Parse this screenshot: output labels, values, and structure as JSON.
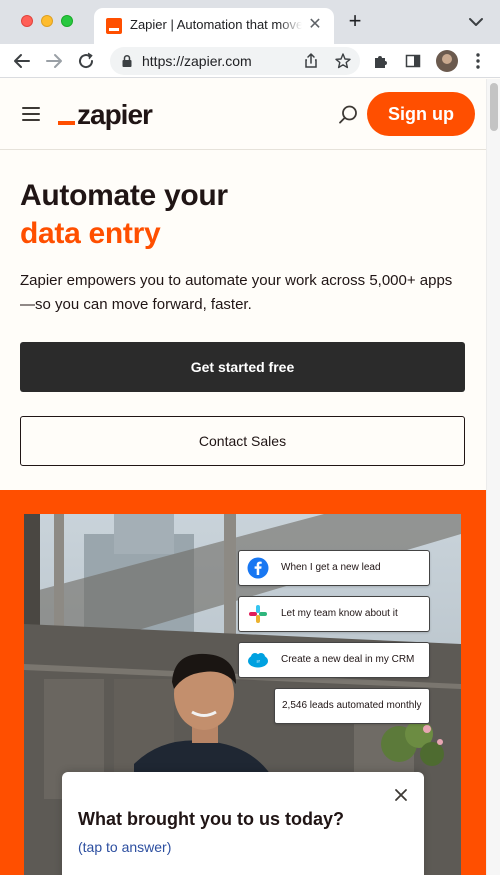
{
  "browser": {
    "tab_title": "Zapier | Automation that moves you forward",
    "tab_close": "✕",
    "new_tab": "+",
    "url": "https://zapier.com"
  },
  "header": {
    "logo_text": "zapier",
    "signup_label": "Sign up"
  },
  "hero": {
    "title_line1": "Automate your",
    "title_line2": "data entry",
    "subtitle": "Zapier empowers you to automate your work across 5,000+ apps —so you can move forward, faster.",
    "cta_primary": "Get started free",
    "cta_secondary": "Contact Sales"
  },
  "workflow": {
    "steps": [
      {
        "label": "When I get a new lead",
        "icon": "facebook-icon"
      },
      {
        "label": "Let my team know about it",
        "icon": "slack-icon"
      },
      {
        "label": "Create a new deal in my CRM",
        "icon": "salesforce-icon"
      },
      {
        "label": "2,546 leads automated monthly",
        "icon": ""
      }
    ]
  },
  "survey": {
    "title": "What brought you to us today?",
    "link": "(tap to answer)"
  },
  "colors": {
    "brand_orange": "#ff4f00",
    "dark": "#201515",
    "cta_dark": "#2b2b2b",
    "cream": "#fffdf9"
  }
}
